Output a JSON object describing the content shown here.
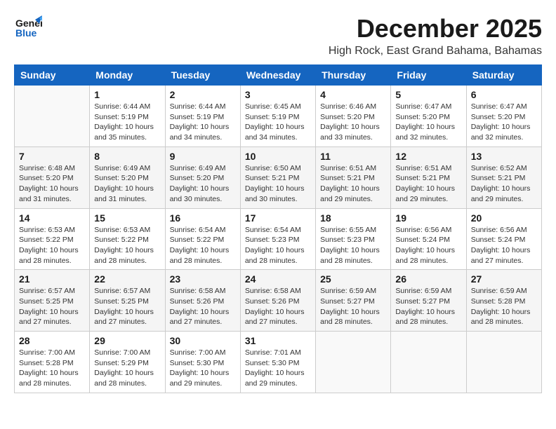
{
  "logo": {
    "line1": "General",
    "line2": "Blue"
  },
  "title": "December 2025",
  "subtitle": "High Rock, East Grand Bahama, Bahamas",
  "headers": [
    "Sunday",
    "Monday",
    "Tuesday",
    "Wednesday",
    "Thursday",
    "Friday",
    "Saturday"
  ],
  "weeks": [
    [
      {
        "day": "",
        "info": ""
      },
      {
        "day": "1",
        "info": "Sunrise: 6:44 AM\nSunset: 5:19 PM\nDaylight: 10 hours\nand 35 minutes."
      },
      {
        "day": "2",
        "info": "Sunrise: 6:44 AM\nSunset: 5:19 PM\nDaylight: 10 hours\nand 34 minutes."
      },
      {
        "day": "3",
        "info": "Sunrise: 6:45 AM\nSunset: 5:19 PM\nDaylight: 10 hours\nand 34 minutes."
      },
      {
        "day": "4",
        "info": "Sunrise: 6:46 AM\nSunset: 5:20 PM\nDaylight: 10 hours\nand 33 minutes."
      },
      {
        "day": "5",
        "info": "Sunrise: 6:47 AM\nSunset: 5:20 PM\nDaylight: 10 hours\nand 32 minutes."
      },
      {
        "day": "6",
        "info": "Sunrise: 6:47 AM\nSunset: 5:20 PM\nDaylight: 10 hours\nand 32 minutes."
      }
    ],
    [
      {
        "day": "7",
        "info": "Sunrise: 6:48 AM\nSunset: 5:20 PM\nDaylight: 10 hours\nand 31 minutes."
      },
      {
        "day": "8",
        "info": "Sunrise: 6:49 AM\nSunset: 5:20 PM\nDaylight: 10 hours\nand 31 minutes."
      },
      {
        "day": "9",
        "info": "Sunrise: 6:49 AM\nSunset: 5:20 PM\nDaylight: 10 hours\nand 30 minutes."
      },
      {
        "day": "10",
        "info": "Sunrise: 6:50 AM\nSunset: 5:21 PM\nDaylight: 10 hours\nand 30 minutes."
      },
      {
        "day": "11",
        "info": "Sunrise: 6:51 AM\nSunset: 5:21 PM\nDaylight: 10 hours\nand 29 minutes."
      },
      {
        "day": "12",
        "info": "Sunrise: 6:51 AM\nSunset: 5:21 PM\nDaylight: 10 hours\nand 29 minutes."
      },
      {
        "day": "13",
        "info": "Sunrise: 6:52 AM\nSunset: 5:21 PM\nDaylight: 10 hours\nand 29 minutes."
      }
    ],
    [
      {
        "day": "14",
        "info": "Sunrise: 6:53 AM\nSunset: 5:22 PM\nDaylight: 10 hours\nand 28 minutes."
      },
      {
        "day": "15",
        "info": "Sunrise: 6:53 AM\nSunset: 5:22 PM\nDaylight: 10 hours\nand 28 minutes."
      },
      {
        "day": "16",
        "info": "Sunrise: 6:54 AM\nSunset: 5:22 PM\nDaylight: 10 hours\nand 28 minutes."
      },
      {
        "day": "17",
        "info": "Sunrise: 6:54 AM\nSunset: 5:23 PM\nDaylight: 10 hours\nand 28 minutes."
      },
      {
        "day": "18",
        "info": "Sunrise: 6:55 AM\nSunset: 5:23 PM\nDaylight: 10 hours\nand 28 minutes."
      },
      {
        "day": "19",
        "info": "Sunrise: 6:56 AM\nSunset: 5:24 PM\nDaylight: 10 hours\nand 28 minutes."
      },
      {
        "day": "20",
        "info": "Sunrise: 6:56 AM\nSunset: 5:24 PM\nDaylight: 10 hours\nand 27 minutes."
      }
    ],
    [
      {
        "day": "21",
        "info": "Sunrise: 6:57 AM\nSunset: 5:25 PM\nDaylight: 10 hours\nand 27 minutes."
      },
      {
        "day": "22",
        "info": "Sunrise: 6:57 AM\nSunset: 5:25 PM\nDaylight: 10 hours\nand 27 minutes."
      },
      {
        "day": "23",
        "info": "Sunrise: 6:58 AM\nSunset: 5:26 PM\nDaylight: 10 hours\nand 27 minutes."
      },
      {
        "day": "24",
        "info": "Sunrise: 6:58 AM\nSunset: 5:26 PM\nDaylight: 10 hours\nand 27 minutes."
      },
      {
        "day": "25",
        "info": "Sunrise: 6:59 AM\nSunset: 5:27 PM\nDaylight: 10 hours\nand 28 minutes."
      },
      {
        "day": "26",
        "info": "Sunrise: 6:59 AM\nSunset: 5:27 PM\nDaylight: 10 hours\nand 28 minutes."
      },
      {
        "day": "27",
        "info": "Sunrise: 6:59 AM\nSunset: 5:28 PM\nDaylight: 10 hours\nand 28 minutes."
      }
    ],
    [
      {
        "day": "28",
        "info": "Sunrise: 7:00 AM\nSunset: 5:28 PM\nDaylight: 10 hours\nand 28 minutes."
      },
      {
        "day": "29",
        "info": "Sunrise: 7:00 AM\nSunset: 5:29 PM\nDaylight: 10 hours\nand 28 minutes."
      },
      {
        "day": "30",
        "info": "Sunrise: 7:00 AM\nSunset: 5:30 PM\nDaylight: 10 hours\nand 29 minutes."
      },
      {
        "day": "31",
        "info": "Sunrise: 7:01 AM\nSunset: 5:30 PM\nDaylight: 10 hours\nand 29 minutes."
      },
      {
        "day": "",
        "info": ""
      },
      {
        "day": "",
        "info": ""
      },
      {
        "day": "",
        "info": ""
      }
    ]
  ]
}
